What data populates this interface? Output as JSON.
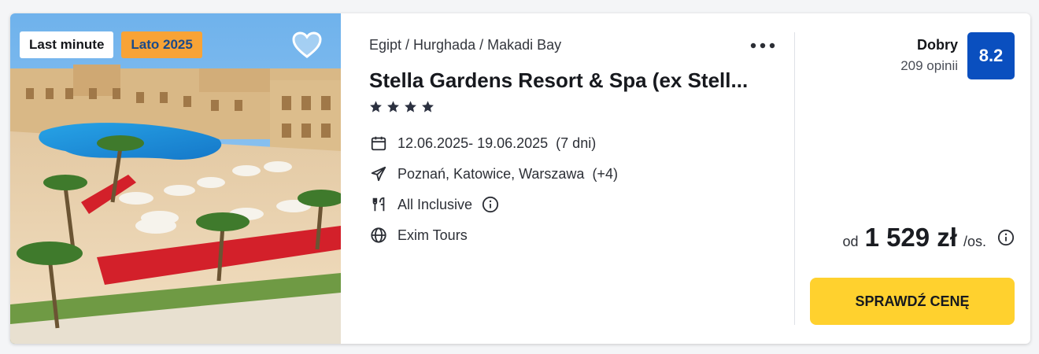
{
  "photo": {
    "badges": {
      "last_minute": "Last minute",
      "season": "Lato 2025"
    }
  },
  "offer": {
    "breadcrumb": "Egipt / Hurghada / Makadi Bay",
    "hotel_name": "Stella Gardens Resort & Spa (ex Stell...",
    "stars": 4,
    "dates": "12.06.2025- 19.06.2025",
    "duration": "(7 dni)",
    "departures": "Poznań, Katowice, Warszawa",
    "departures_extra": "(+4)",
    "board": "All Inclusive",
    "operator": "Exim Tours"
  },
  "rating": {
    "label": "Dobry",
    "reviews": "209 opinii",
    "score": "8.2"
  },
  "price": {
    "prefix": "od",
    "amount": "1 529 zł",
    "unit": "/os."
  },
  "cta_label": "SPRAWDŹ CENĘ",
  "colors": {
    "accent_yellow": "#ffd12e",
    "score_blue": "#0a4fbf",
    "season_orange": "#f8a336"
  }
}
